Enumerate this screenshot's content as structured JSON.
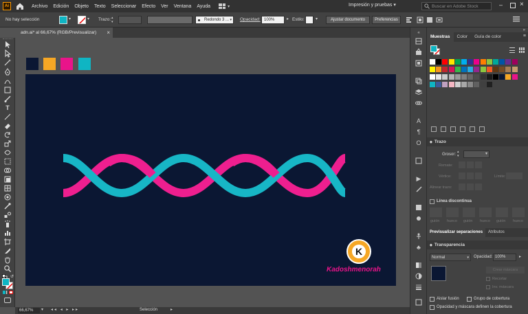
{
  "app": {
    "logo": "Ai",
    "menu": [
      "Archivo",
      "Edición",
      "Objeto",
      "Texto",
      "Seleccionar",
      "Efecto",
      "Ver",
      "Ventana",
      "Ayuda"
    ],
    "workspace": "Impresión y pruebas",
    "search_placeholder": "Buscar en Adobe Stock"
  },
  "control": {
    "selection_status": "No hay selección",
    "stroke_label": "Trazo:",
    "brush_label": "Redondo 3 ...",
    "opacity_label": "Opacidad:",
    "opacity_value": "100%",
    "style_label": "Estilo:",
    "adjust_doc_label": "Ajustar documento",
    "prefs_label": "Preferencias"
  },
  "document": {
    "tab_title": "adn.ai* al 66,67% (RGB/Previsualizar)",
    "close_glyph": "×",
    "artboard_color": "#0b1733",
    "swatches": [
      "#0b1733",
      "#f6a725",
      "#e9148a",
      "#0fb5c3"
    ],
    "helix_colors": {
      "cyan": "#17b6c6",
      "pink": "#ee1f8f"
    },
    "watermark_letter": "K",
    "watermark_text": "Kadoshmenorah"
  },
  "status": {
    "zoom": "66,67%",
    "mode": "Selección"
  },
  "panels": {
    "swatch_tabs": [
      "Muestras",
      "Color",
      "Guía de color"
    ],
    "swatch_colors_row1": [
      "#ffffff",
      "#000000",
      "#ff0000",
      "#ffe600",
      "#00a651",
      "#00aeef",
      "#2e3192",
      "#ec008c",
      "#ff7f00",
      "#8cc63f",
      "#00a99d",
      "#0054a6",
      "#662d91",
      "#9e005d"
    ],
    "swatch_colors_row2": [
      "#fff200",
      "#f7941d",
      "#c1272d",
      "#d4145a",
      "#39b54a",
      "#0071bc",
      "#29abe2",
      "#93278f",
      "#8dc63f",
      "#f15a24",
      "#603813",
      "#754c24",
      "#a67c52",
      "#c69c6d"
    ],
    "swatch_colors_row3": [
      "#ffffff",
      "#e6e6e6",
      "#cccccc",
      "#b3b3b3",
      "#999999",
      "#808080",
      "#666666",
      "#4d4d4d",
      "#333333",
      "#1a1a1a",
      "#000000",
      "#0b1733",
      "#f6a725",
      "#e9148a"
    ],
    "swatch_colors_row4": [
      "#0fb5c3",
      "#3c5a9a",
      "#c0a0c0",
      "#f4b6c2",
      "#d0d0d0",
      "#a8a8a8",
      "#888888",
      "#606060",
      "#404040",
      "#202020"
    ],
    "stroke": {
      "title": "Trazo",
      "weight_label": "Grosor:",
      "cap_label": "Remate:",
      "corner_label": "Vértice:",
      "limit_label": "Límite:",
      "align_label": "Alinear trazo:"
    },
    "dashed": {
      "label": "Línea discontinua",
      "fields": [
        "guión",
        "hueco",
        "guión",
        "hueco",
        "guión",
        "hueco"
      ]
    },
    "sep_tabs": [
      "Previsualizar separaciones",
      "Atributos"
    ],
    "transparency": {
      "title": "Transparencia",
      "blend_mode": "Normal",
      "opacity_label": "Opacidad:",
      "opacity_value": "100%",
      "make_mask": "Crear máscara",
      "clip": "Recortar",
      "invert": "Inv. máscara",
      "isolate": "Aislar fusión",
      "knockout": "Grupo de cobertura",
      "opacity_mask": "Opacidad y máscara definen la cobertura"
    }
  }
}
